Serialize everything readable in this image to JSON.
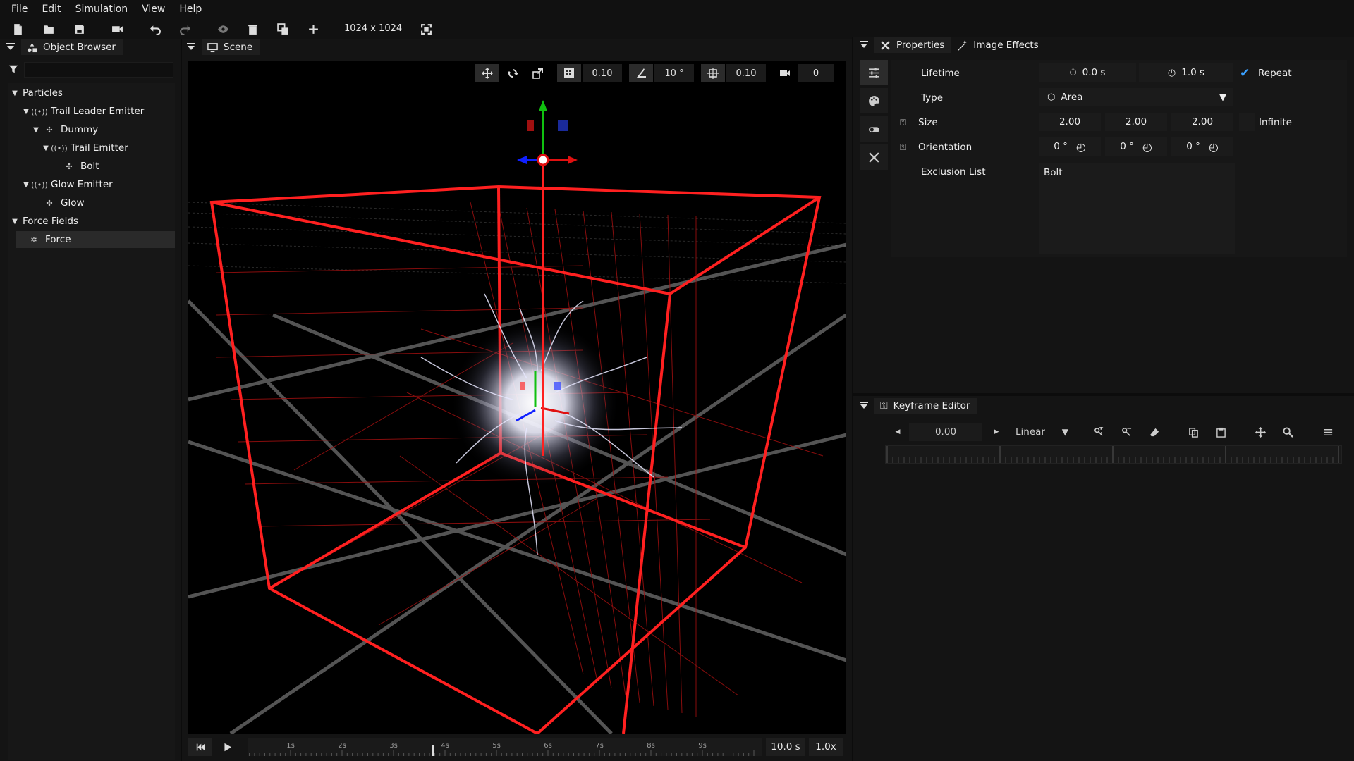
{
  "menu": [
    "File",
    "Edit",
    "Simulation",
    "View",
    "Help"
  ],
  "toolbar": {
    "resolution": "1024 x 1024"
  },
  "object_browser": {
    "title": "Object Browser",
    "filter_placeholder": "",
    "items": [
      {
        "label": "Particles",
        "kind": "folder",
        "icon": "none"
      },
      {
        "label": "Trail Leader Emitter",
        "kind": "emitter",
        "icon": "emitter-icon"
      },
      {
        "label": "Dummy",
        "kind": "particle",
        "icon": "particle-icon"
      },
      {
        "label": "Trail Emitter",
        "kind": "emitter",
        "icon": "emitter-icon"
      },
      {
        "label": "Bolt",
        "kind": "particle",
        "icon": "particle-icon"
      },
      {
        "label": "Glow Emitter",
        "kind": "emitter",
        "icon": "emitter-icon"
      },
      {
        "label": "Glow",
        "kind": "particle",
        "icon": "particle-icon"
      },
      {
        "label": "Force Fields",
        "kind": "folder",
        "icon": "none"
      },
      {
        "label": "Force",
        "kind": "force",
        "icon": "force-icon"
      }
    ]
  },
  "scene": {
    "title": "Scene",
    "grid_size": "0.10",
    "angle_snap": "10 °",
    "scale_snap": "0.10",
    "camera": "0"
  },
  "timeline": {
    "ticks": [
      "1s",
      "2s",
      "3s",
      "4s",
      "5s",
      "6s",
      "7s",
      "8s",
      "9s"
    ],
    "duration": "10.0 s",
    "speed": "1.0x",
    "playhead_seconds": 3.75
  },
  "properties": {
    "tab_properties": "Properties",
    "tab_image_effects": "Image Effects",
    "lifetime_label": "Lifetime",
    "lifetime_start": "0.0 s",
    "lifetime_end": "1.0 s",
    "repeat_label": "Repeat",
    "type_label": "Type",
    "type_value": "Area",
    "size_label": "Size",
    "size": [
      "2.00",
      "2.00",
      "2.00"
    ],
    "infinite_label": "Infinite",
    "orientation_label": "Orientation",
    "orientation": [
      "0 °",
      "0 °",
      "0 °"
    ],
    "exclusion_label": "Exclusion List",
    "exclusion_items": "Bolt"
  },
  "keyframe_editor": {
    "title": "Keyframe Editor",
    "time": "0.00",
    "interpolation": "Linear"
  },
  "colors": {
    "accent_red": "#ff2020",
    "selection": "#2a2a2a",
    "check_blue": "#3aa0ff"
  }
}
